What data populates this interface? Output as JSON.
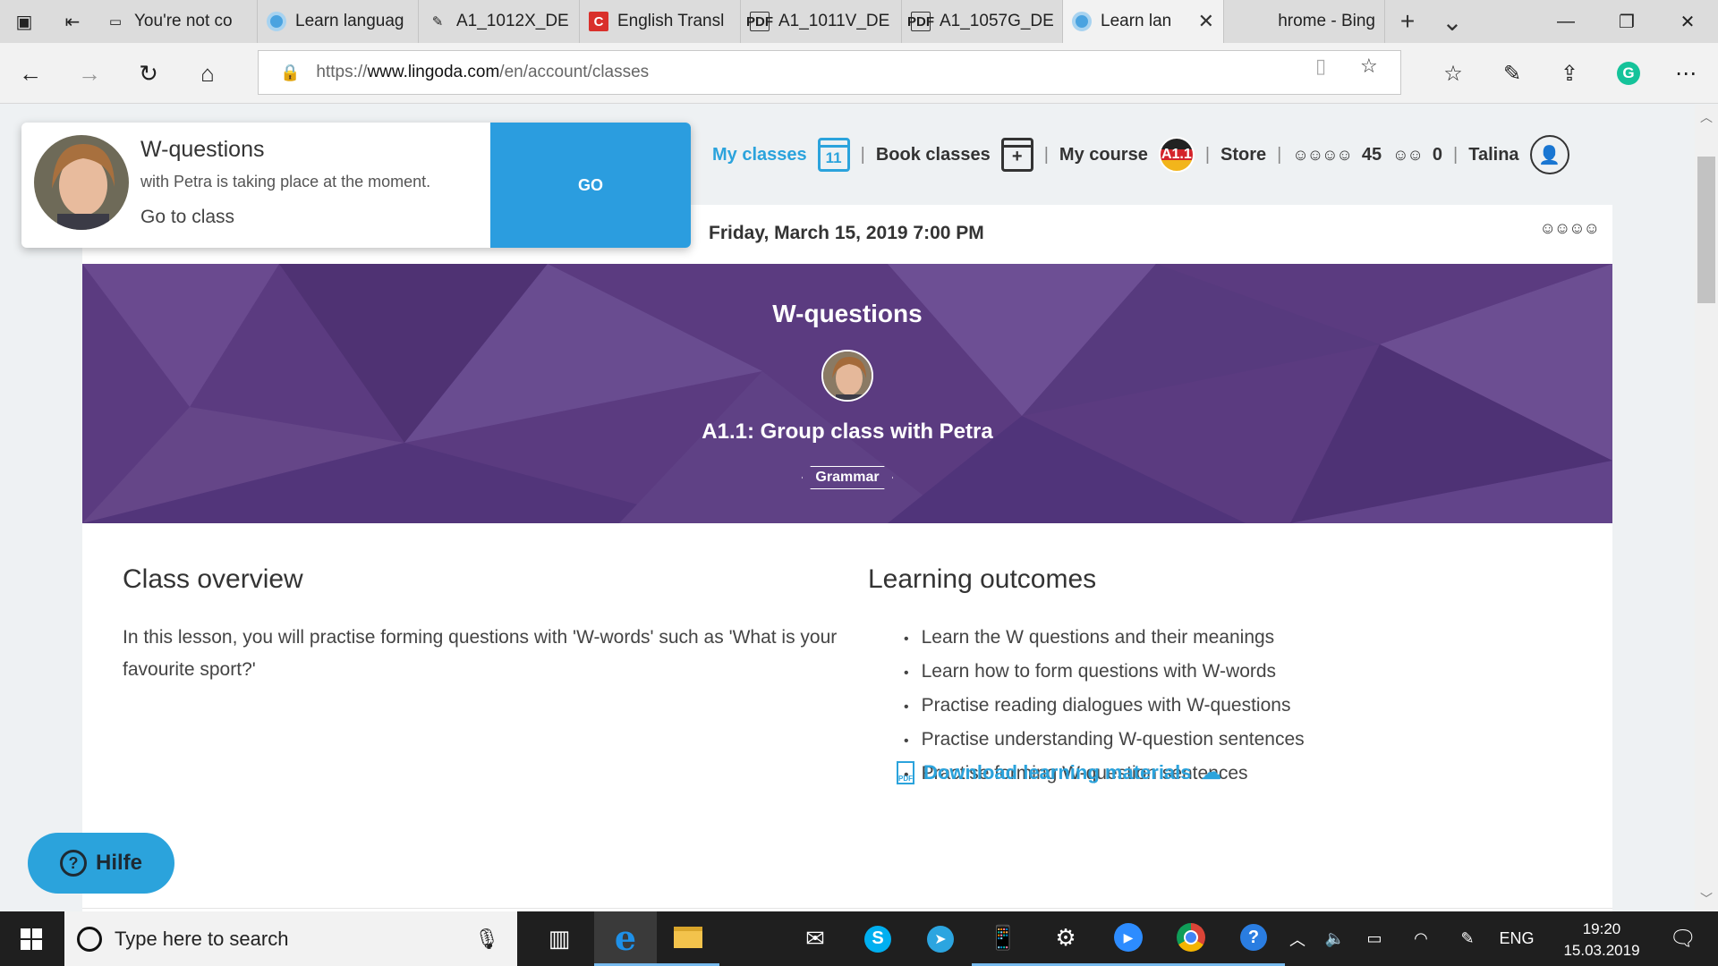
{
  "browser": {
    "tabs": [
      {
        "label": "You're not co",
        "icon": "page-icon"
      },
      {
        "label": "Learn languag",
        "icon": "lingoda-icon"
      },
      {
        "label": "A1_1012X_DE",
        "icon": "pen-icon"
      },
      {
        "label": "English Transl",
        "icon": "reverso-icon"
      },
      {
        "label": "A1_1011V_DE",
        "icon": "pdf-icon"
      },
      {
        "label": "A1_1057G_DE",
        "icon": "pdf-icon"
      },
      {
        "label": "Learn lan",
        "icon": "lingoda-icon",
        "active": true
      },
      {
        "label": "hrome - Bing",
        "icon": "none"
      }
    ],
    "url_prefix": "https://",
    "url_host": "www.lingoda.com",
    "url_path": "/en/account/classes"
  },
  "nav": {
    "my_classes": "My classes",
    "calendar_day": "11",
    "book_classes": "Book classes",
    "my_course": "My course",
    "course_level": "A1.1",
    "store": "Store",
    "group_credits": "45",
    "private_credits": "0",
    "username": "Talina"
  },
  "notification": {
    "title": "W-questions",
    "message": "with Petra is taking place at the moment.",
    "link": "Go to class",
    "button": "GO"
  },
  "class": {
    "datetime": "Friday, March 15, 2019 7:00 PM",
    "title": "W-questions",
    "subtitle": "A1.1: Group class with Petra",
    "tag": "Grammar",
    "banner_color": "#5b3b80",
    "overview_heading": "Class overview",
    "overview_text": "In this lesson, you will practise forming questions with 'W-words' such as 'What is your favourite sport?'",
    "outcomes_heading": "Learning outcomes",
    "outcomes": [
      "Learn the W questions and their meanings",
      "Learn how to form questions with W-words",
      "Practise reading dialogues with W-questions",
      "Practise understanding W-question sentences",
      "Practise forming W-question sentences"
    ],
    "download": "Download learning materials"
  },
  "help": {
    "label": "Hilfe"
  },
  "taskbar": {
    "search_placeholder": "Type here to search",
    "language": "ENG",
    "time": "19:20",
    "date": "15.03.2019"
  },
  "colors": {
    "accent": "#2ba3dc",
    "go_button": "#2b9ddf"
  }
}
